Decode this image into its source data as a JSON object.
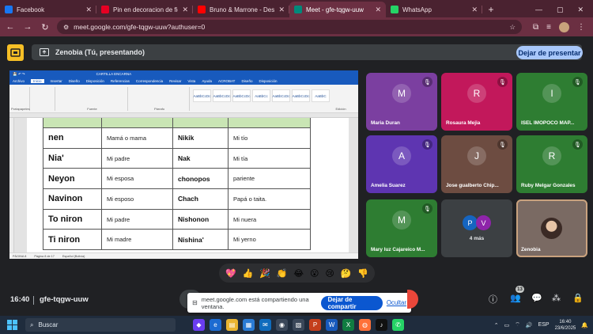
{
  "browser": {
    "tabs": [
      {
        "title": "Facebook",
        "color": "#1877f2",
        "active": false
      },
      {
        "title": "Pin en decoracion de fiestas",
        "color": "#e60023",
        "active": false
      },
      {
        "title": "Bruno & Marrone - Desligue",
        "color": "#ff0000",
        "active": false
      },
      {
        "title": "Meet - gfe-tqgw-uuw",
        "color": "#00897b",
        "active": true
      },
      {
        "title": "WhatsApp",
        "color": "#25d366",
        "active": false
      }
    ],
    "new_tab": "+",
    "url": "meet.google.com/gfe-tqgw-uuw?authuser=0"
  },
  "presenting": {
    "label": "Zenobia (Tú, presentando)",
    "stop_label": "Dejar de presentar"
  },
  "document": {
    "title": "CARTILLA ENCARNA",
    "rows": [
      {
        "word": "nen",
        "translation": "Mamá o mama",
        "word2": "Nikik",
        "translation2": "Mi tío"
      },
      {
        "word": "Nia'",
        "translation": "Mi padre",
        "word2": "Nak",
        "translation2": "Mi tía"
      },
      {
        "word": "Neyon",
        "translation": "Mi esposa",
        "word2": "chonopos",
        "translation2": "pariente"
      },
      {
        "word": "Navinon",
        "translation": "Mi esposo",
        "word2": "Chach",
        "translation2": "Papá o taita."
      },
      {
        "word": "To niron",
        "translation": "Mi padre",
        "word2": "Nishonon",
        "translation2": "Mi nuera"
      },
      {
        "word": "Ti niron",
        "translation": "Mi madre",
        "word2": "Nishina'",
        "translation2": "Mi yerno"
      }
    ],
    "ribbon_tabs": [
      "Archivo",
      "Inicio",
      "Insertar",
      "Diseño",
      "Disposición",
      "Referencias",
      "Correspondencia",
      "Revisar",
      "Vista",
      "Ayuda",
      "ACROBAT",
      "Diseño",
      "Disposición"
    ],
    "styles": [
      "AaBbCcDc",
      "AaBbCcDc",
      "AaBbCcDc",
      "AaBbCc",
      "AaBbCcDc",
      "AaBbCcDc",
      "AaBbC"
    ],
    "status": {
      "page": "PÁGINA 8",
      "words": "Página 8 de 17",
      "lang": "Español (Bolivia)"
    }
  },
  "participants": [
    {
      "initial": "M",
      "name": "Maria Duran",
      "color": "#7b3fa0",
      "muted": true
    },
    {
      "initial": "R",
      "name": "Rosaura Mejia",
      "color": "#c2185b",
      "muted": true
    },
    {
      "initial": "I",
      "name": "ISEL IMOPOCO MAP...",
      "color": "#2e7d32",
      "muted": true
    },
    {
      "initial": "A",
      "name": "Amelia Suarez",
      "color": "#5e35b1",
      "muted": true
    },
    {
      "initial": "J",
      "name": "Jose gualberto Chip...",
      "color": "#6d4c41",
      "muted": true
    },
    {
      "initial": "R",
      "name": "Ruby Melgar Gonzales",
      "color": "#2e7d32",
      "muted": true
    },
    {
      "initial": "M",
      "name": "Mary luz Cajareico M...",
      "color": "#2e7d32",
      "muted": true
    }
  ],
  "more": {
    "count_label": "4 más",
    "a": "P",
    "b": "V",
    "a_color": "#1565c0",
    "b_color": "#8e24aa"
  },
  "self_tile": {
    "name": "Zenobia"
  },
  "reactions": [
    "💖",
    "👍",
    "🎉",
    "👏",
    "😂",
    "😮",
    "😢",
    "🤔",
    "👎"
  ],
  "meeting": {
    "time": "16:40",
    "code": "gfe-tqgw-uuw",
    "participant_count": "13"
  },
  "share_notice": {
    "message": "meet.google.com está compartiendo una ventana.",
    "share_button": "Dejar de compartir",
    "hide_link": "Ocultar"
  },
  "taskbar": {
    "search_placeholder": "Buscar",
    "lang": "ESP",
    "clock_time": "16:40",
    "clock_date": "23/6/2025"
  }
}
